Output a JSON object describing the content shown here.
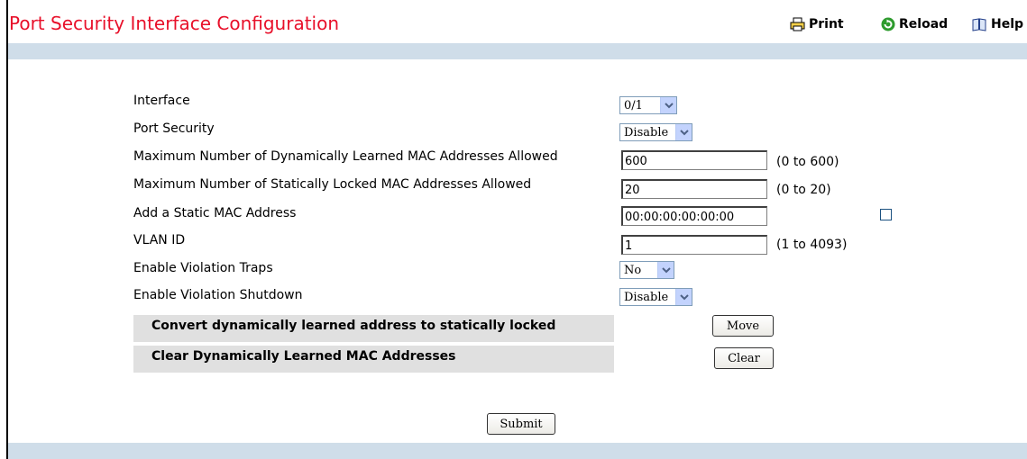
{
  "page": {
    "title": "Port Security Interface Configuration"
  },
  "toolbar": {
    "print_label": "Print",
    "reload_label": "Reload",
    "help_label": "Help"
  },
  "form": {
    "interface": {
      "label": "Interface",
      "value": "0/1"
    },
    "port_security": {
      "label": "Port Security",
      "value": "Disable"
    },
    "max_dynamic": {
      "label": "Maximum Number of Dynamically Learned MAC Addresses Allowed",
      "value": "600",
      "range": "(0 to 600)"
    },
    "max_static": {
      "label": "Maximum Number of Statically Locked MAC Addresses Allowed",
      "value": "20",
      "range": "(0 to 20)"
    },
    "static_mac": {
      "label": "Add a Static MAC Address",
      "value": "00:00:00:00:00:00",
      "checked": false
    },
    "vlan_id": {
      "label": "VLAN ID",
      "value": "1",
      "range": "(1 to 4093)"
    },
    "violation_traps": {
      "label": "Enable Violation Traps",
      "value": "No"
    },
    "violation_shutdown": {
      "label": "Enable Violation Shutdown",
      "value": "Disable"
    }
  },
  "actions": {
    "convert": {
      "label": "Convert dynamically learned address to statically locked",
      "button": "Move"
    },
    "clear": {
      "label": "Clear Dynamically Learned MAC Addresses",
      "button": "Clear"
    },
    "submit": "Submit"
  },
  "colors": {
    "title": "#e8102a",
    "band": "#cfdde9",
    "action_bar": "#e0e0e0"
  },
  "icons": {
    "print": "printer-icon",
    "reload": "reload-icon",
    "help": "help-book-icon",
    "dropdown": "chevron-down-icon"
  }
}
